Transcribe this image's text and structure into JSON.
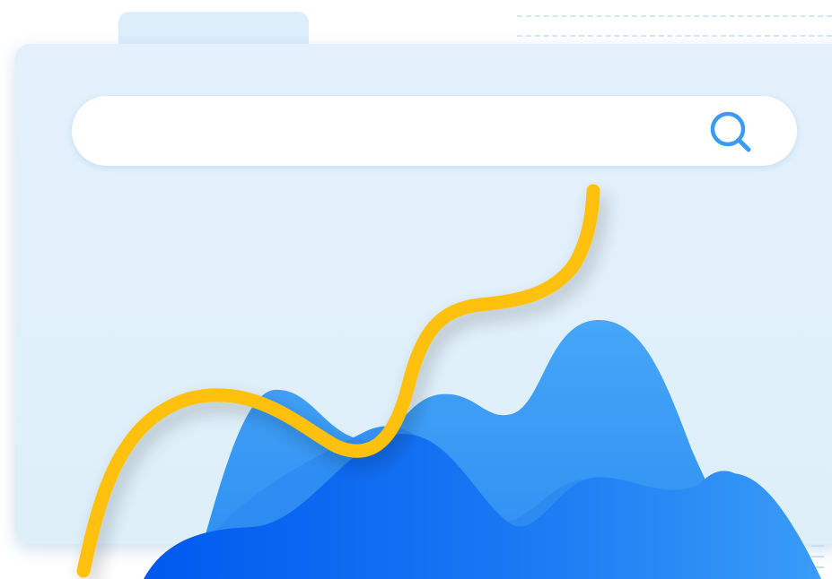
{
  "search": {
    "value": "",
    "placeholder": "",
    "icon": "search-icon",
    "icon_color": "#3b9bef"
  },
  "colors": {
    "folder": "#ddeefb",
    "wave_light": "#3f9ff6",
    "wave_dark": "#1a73f0",
    "trend_line": "#ffc107"
  }
}
